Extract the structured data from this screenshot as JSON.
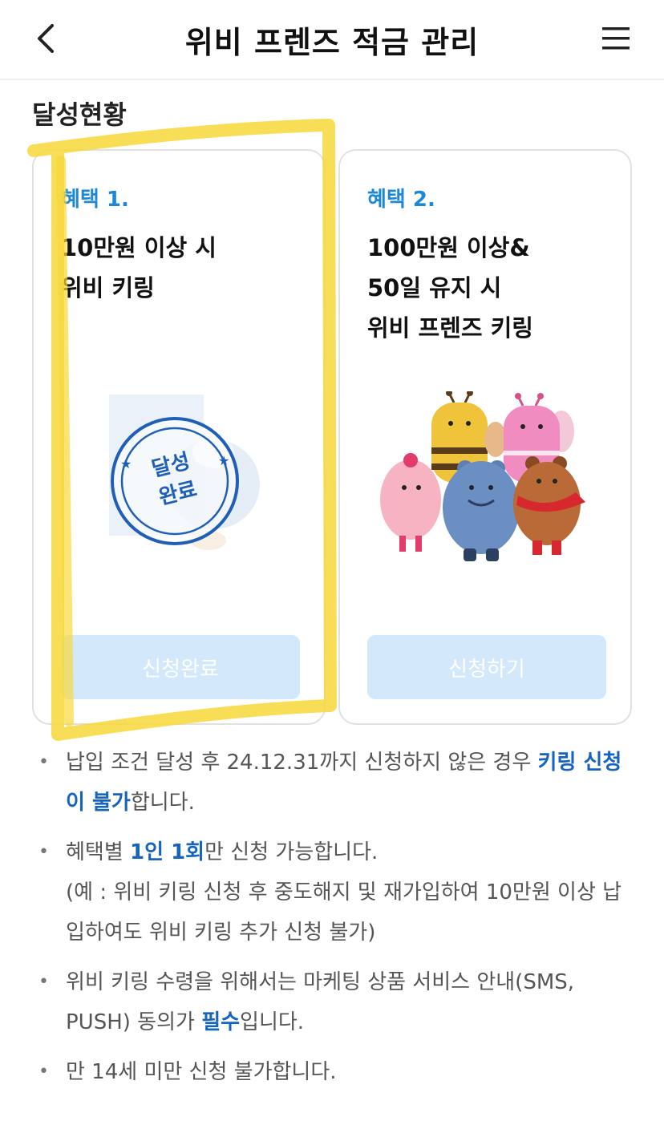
{
  "header": {
    "title": "위비 프렌즈 적금 관리",
    "back_icon": "chevron-left-icon",
    "menu_icon": "hamburger-menu-icon"
  },
  "section": {
    "title": "달성현황"
  },
  "cards": [
    {
      "tag": "혜택 1.",
      "lines": [
        "10만원 이상 시",
        "위비 키링"
      ],
      "stamp": [
        "달성",
        "완료"
      ],
      "button": "신청완료"
    },
    {
      "tag": "혜택 2.",
      "lines": [
        "100만원 이상&",
        "50일 유지 시",
        "위비 프렌즈 키링"
      ],
      "button": "신청하기"
    }
  ],
  "notes": [
    {
      "parts": [
        "납입 조건 달성 후 24.12.31까지 신청하지 않은 경우 ",
        "키링 신청이 불가",
        "합니다."
      ]
    },
    {
      "parts": [
        "혜택별 ",
        "1인 1회",
        "만 신청 가능합니다."
      ],
      "extra": "(예 : 위비 키링 신청 후 중도해지 및 재가입하여 10만원 이상 납입하여도 위비 키링 추가 신청 불가)"
    },
    {
      "parts": [
        "위비 키링 수령을 위해서는 마케팅 상품 서비스 안내(SMS, PUSH) 동의가 ",
        "필수",
        "입니다."
      ]
    },
    {
      "parts": [
        "만 14세 미만 신청 불가합니다."
      ]
    }
  ],
  "colors": {
    "accent": "#1e88d8",
    "emphasis": "#1565c0",
    "button_disabled": "#d3e8fb",
    "highlight": "#f7d83a",
    "stamp": "#1f5fb8"
  }
}
